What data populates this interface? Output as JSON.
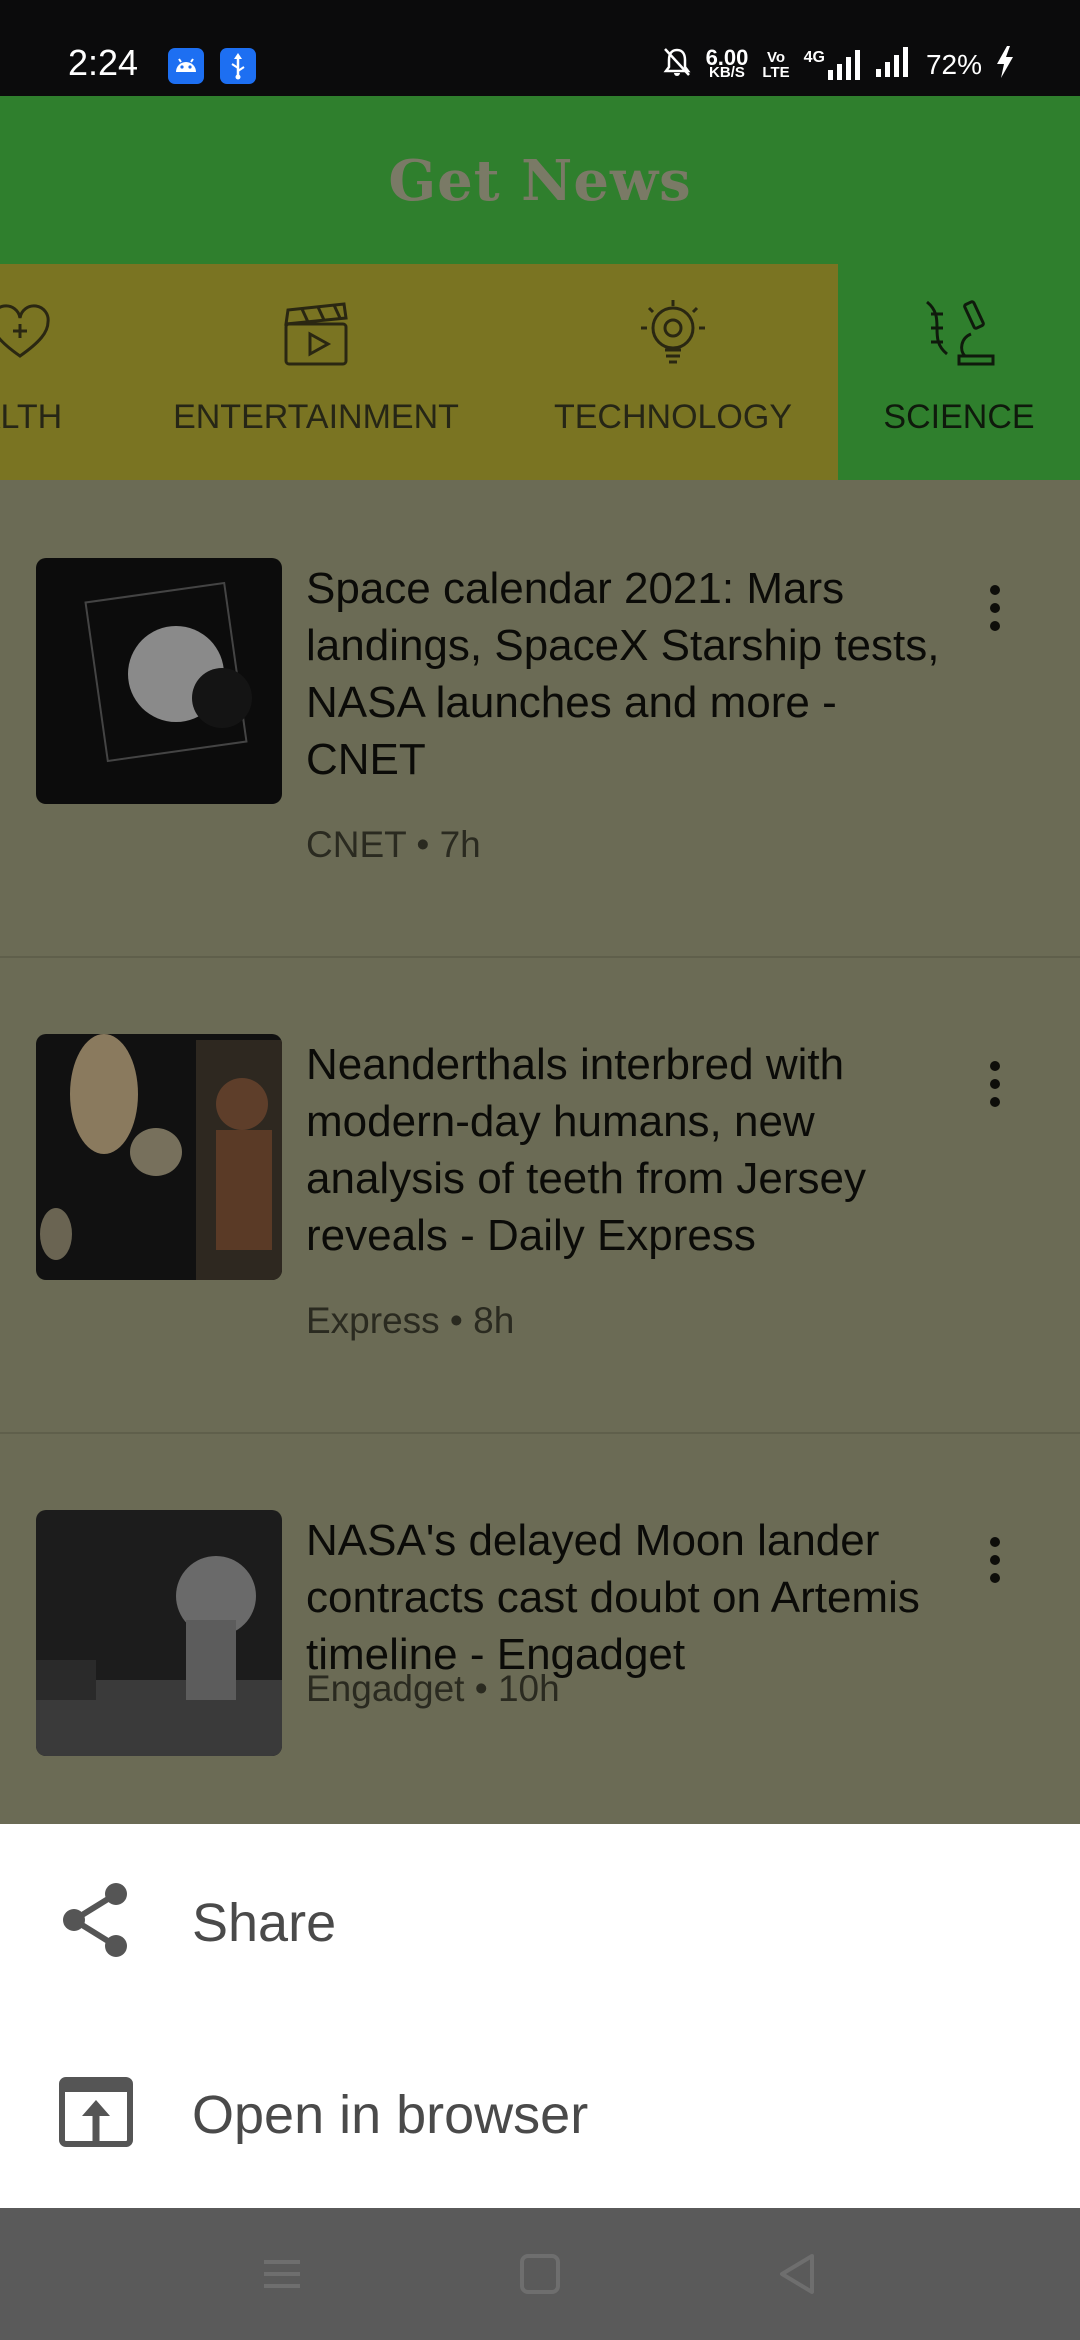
{
  "status_bar": {
    "time": "2:24",
    "speed_value": "6.00",
    "speed_unit": "KB/S",
    "volte_top": "Vo",
    "volte_bottom": "LTE",
    "network": "4G",
    "battery": "72%",
    "icons": [
      "android-icon",
      "usb-icon",
      "mute-bell-icon",
      "signal-icon",
      "charging-icon"
    ]
  },
  "header": {
    "title": "Get News"
  },
  "tabs": [
    {
      "label": "ALTH",
      "icon": "health-icon",
      "active": false
    },
    {
      "label": "ENTERTAINMENT",
      "icon": "clapperboard-icon",
      "active": false
    },
    {
      "label": "TECHNOLOGY",
      "icon": "lightbulb-gear-icon",
      "active": false
    },
    {
      "label": "SCIENCE",
      "icon": "dna-microscope-icon",
      "active": true
    }
  ],
  "articles": [
    {
      "title": "Space calendar 2021: Mars landings, SpaceX Starship tests, NASA launches and more - CNET",
      "meta": "CNET • 7h"
    },
    {
      "title": "Neanderthals interbred with modern-day humans, new analysis of teeth from Jersey reveals - Daily Express",
      "meta": "Express • 8h"
    },
    {
      "title": "NASA's delayed Moon lander contracts cast doubt on Artemis timeline - Engadget",
      "meta": "Engadget • 10h"
    }
  ],
  "sheet": {
    "share_label": "Share",
    "open_browser_label": "Open in browser"
  },
  "colors": {
    "header_green": "#2f7f2d",
    "tab_bar_yellow": "#7a7422",
    "scrim_background": "#6b6b55",
    "sheet_white": "#ffffff"
  }
}
